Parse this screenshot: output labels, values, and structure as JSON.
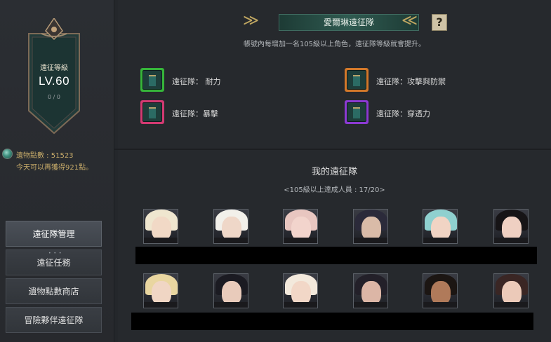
{
  "sidebar": {
    "banner": {
      "title": "遠征等級",
      "level": "LV.60",
      "exp": "0 / 0"
    },
    "points": {
      "label": "遺物點數 : ",
      "value": "51523",
      "today": "今天可以再獲得921點。"
    },
    "menu": [
      {
        "label": "遠征隊管理",
        "active": true
      },
      {
        "label": "遠征任務",
        "active": false,
        "indicator": "• • •"
      },
      {
        "label": "遺物點數商店",
        "active": false
      },
      {
        "label": "冒險夥伴遠征隊",
        "active": false
      }
    ]
  },
  "header": {
    "title": "愛爾琳遠征隊",
    "help_label": "?",
    "subtitle": "帳號內每增加一名105級以上角色，遠征隊等級就會提升。",
    "chevron_left": "≫",
    "chevron_right": "≪"
  },
  "bonuses": [
    {
      "label": "遠征隊： 耐力",
      "color": "#36b53a"
    },
    {
      "label": "遠征隊：攻擊與防禦",
      "color": "#d2782a"
    },
    {
      "label": "遠征隊：暴擊",
      "color": "#d23a72"
    },
    {
      "label": "遠征隊：穿透力",
      "color": "#8b3ad2"
    }
  ],
  "expedition": {
    "title": "我的遠征隊",
    "requirement": "<105級以上達成人員 : 17/20>",
    "row1": [
      {
        "hair": "#efe6cf",
        "skin": "#f1d9c6"
      },
      {
        "hair": "#f2f0ea",
        "skin": "#efd7c8"
      },
      {
        "hair": "#e8c6c0",
        "skin": "#f2d4cc"
      },
      {
        "hair": "#2b2a3a",
        "skin": "#d9bba8"
      },
      {
        "hair": "#8fd0cf",
        "skin": "#f1d4c4"
      },
      {
        "hair": "#161416",
        "skin": "#efd0c2"
      }
    ],
    "row2": [
      {
        "hair": "#e9d6a0",
        "skin": "#f0d6c4"
      },
      {
        "hair": "#1b1b22",
        "skin": "#e9cbbb"
      },
      {
        "hair": "#f3e9dc",
        "skin": "#f2d7c7"
      },
      {
        "hair": "#232029",
        "skin": "#dcb6a6"
      },
      {
        "hair": "#1c1613",
        "skin": "#b07a5a"
      },
      {
        "hair": "#3a2624",
        "skin": "#eccab9"
      }
    ]
  },
  "colors": {
    "accent_gold": "#c9ad6a",
    "title_green": "#2f5a50",
    "background": "#24272b"
  }
}
